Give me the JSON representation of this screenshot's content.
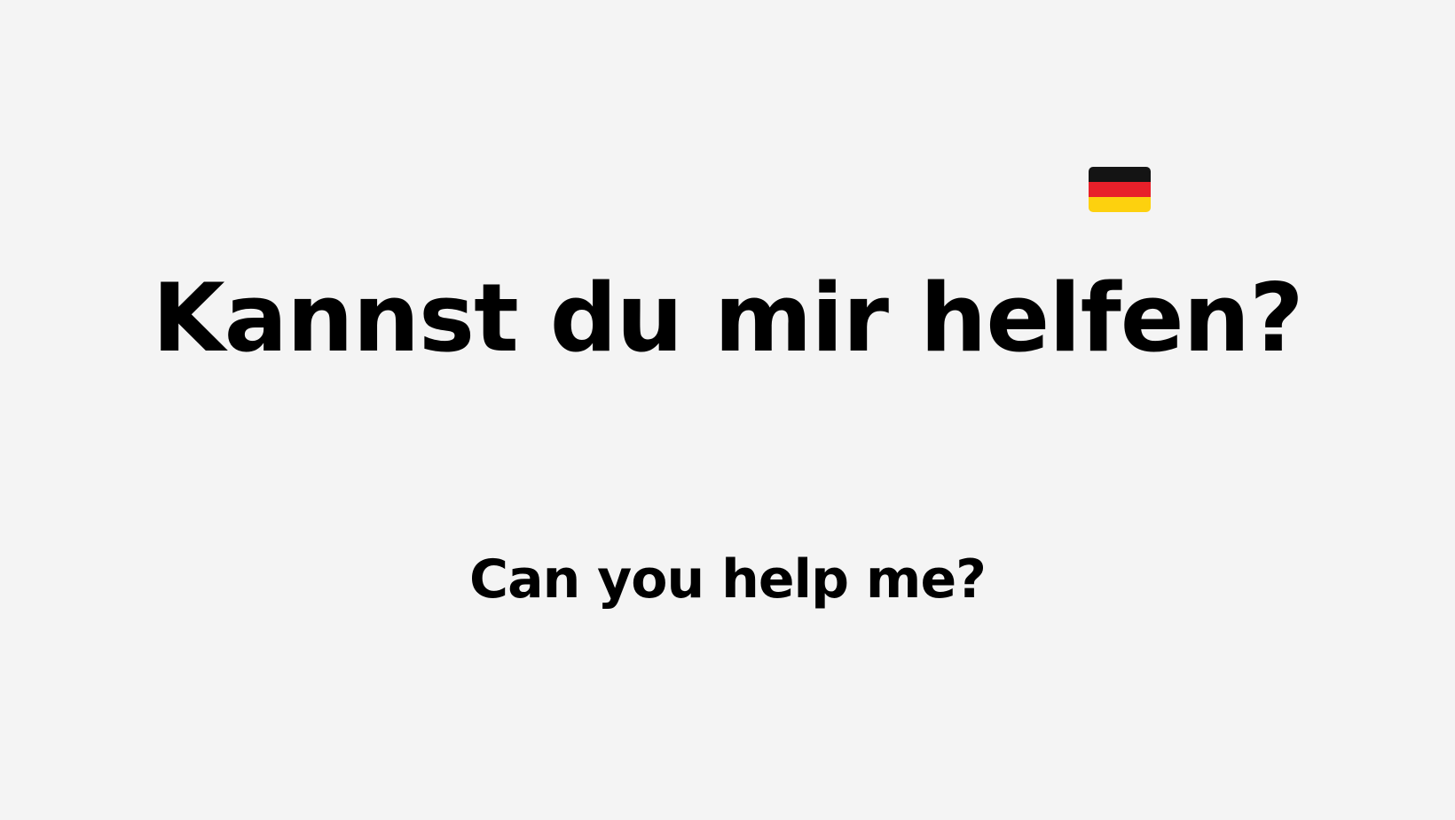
{
  "flag": {
    "icon": "german-flag-icon",
    "colors": [
      "#141414",
      "#e8202a",
      "#fdd10e"
    ]
  },
  "phrase": {
    "german": "Kannst du mir helfen?",
    "english": "Can you help me?"
  }
}
